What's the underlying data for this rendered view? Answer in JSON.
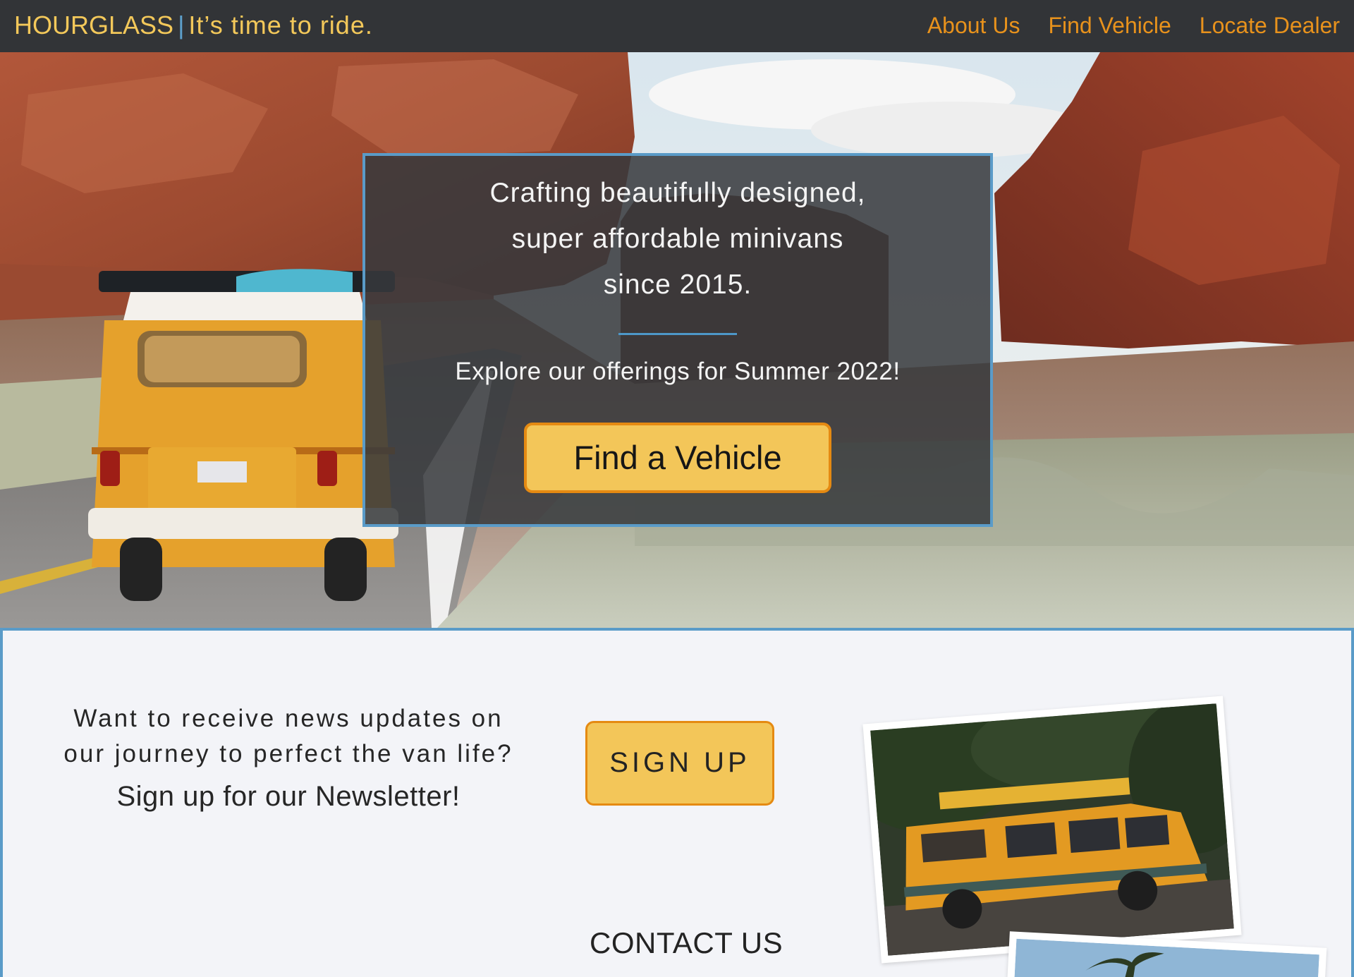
{
  "nav": {
    "brand_name": "HOURGLASS",
    "brand_separator": "|",
    "tagline": "It’s time to ride.",
    "links": [
      {
        "label": "About Us"
      },
      {
        "label": "Find Vehicle"
      },
      {
        "label": "Locate Dealer"
      }
    ]
  },
  "hero": {
    "heading_line1": "Crafting beautifully designed,",
    "heading_line2": "super affordable minivans",
    "heading_line3": "since 2015.",
    "subheading": "Explore our offerings for Summer 2022!",
    "button_label": "Find a Vehicle"
  },
  "newsletter": {
    "question_line1": "Want to receive news updates on",
    "question_line2": "our journey to perfect the van life?",
    "cta": "Sign up for our Newsletter!",
    "button_label": "SIGN UP"
  },
  "contact": {
    "heading": "CONTACT US"
  },
  "colors": {
    "nav_bg": "#323437",
    "brand": "#f3c85a",
    "nav_link": "#e8921c",
    "accent_blue": "#5a9bc8",
    "button_yellow": "#f3c659",
    "button_border": "#e58a12",
    "page_bg": "#f3f4f8"
  }
}
